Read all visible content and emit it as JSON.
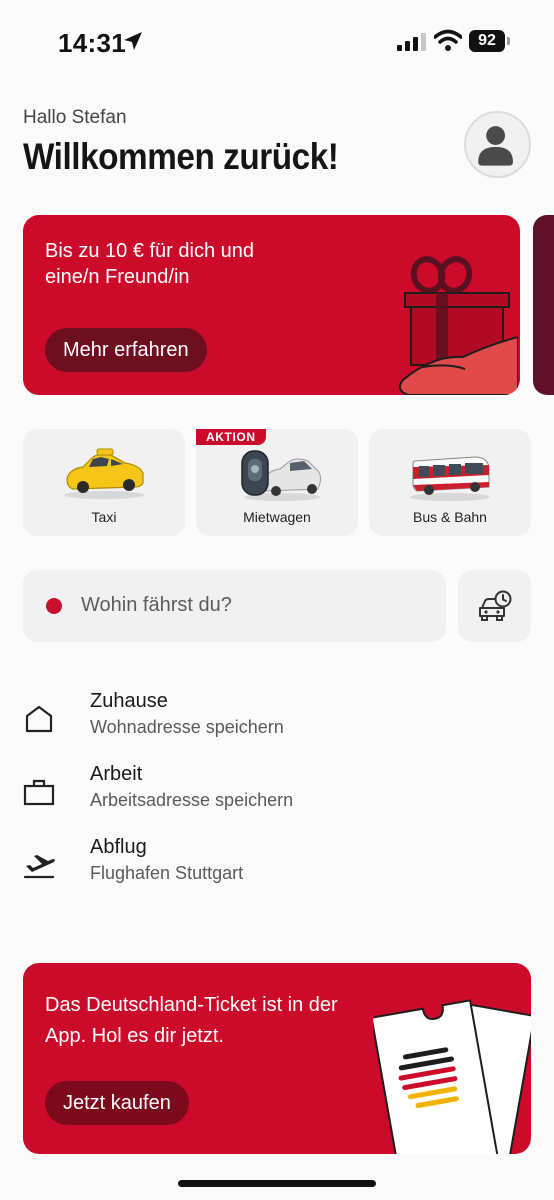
{
  "status_bar": {
    "time": "14:31",
    "battery": "92"
  },
  "header": {
    "greeting": "Hallo Stefan",
    "title": "Willkommen zurück!"
  },
  "promo": {
    "text": "Bis zu 10 € für dich und eine/n Freund/in",
    "button": "Mehr erfahren"
  },
  "modes": [
    {
      "label": "Taxi",
      "icon": "taxi-icon"
    },
    {
      "label": "Mietwagen",
      "icon": "rental-car-icon",
      "badge": "AKTION"
    },
    {
      "label": "Bus & Bahn",
      "icon": "bus-icon"
    }
  ],
  "search": {
    "placeholder": "Wohin fährst du?"
  },
  "places": [
    {
      "title": "Zuhause",
      "subtitle": "Wohnadresse speichern",
      "icon": "home-icon"
    },
    {
      "title": "Arbeit",
      "subtitle": "Arbeitsadresse speichern",
      "icon": "briefcase-icon"
    },
    {
      "title": "Abflug",
      "subtitle": "Flughafen Stuttgart",
      "icon": "airplane-departure-icon"
    }
  ],
  "ticket": {
    "text": "Das Deutschland-Ticket ist in der App. Hol es dir jetzt.",
    "button": "Jetzt kaufen"
  },
  "colors": {
    "brand_red": "#cc0b2b",
    "dark_red": "#6e0f1f"
  }
}
